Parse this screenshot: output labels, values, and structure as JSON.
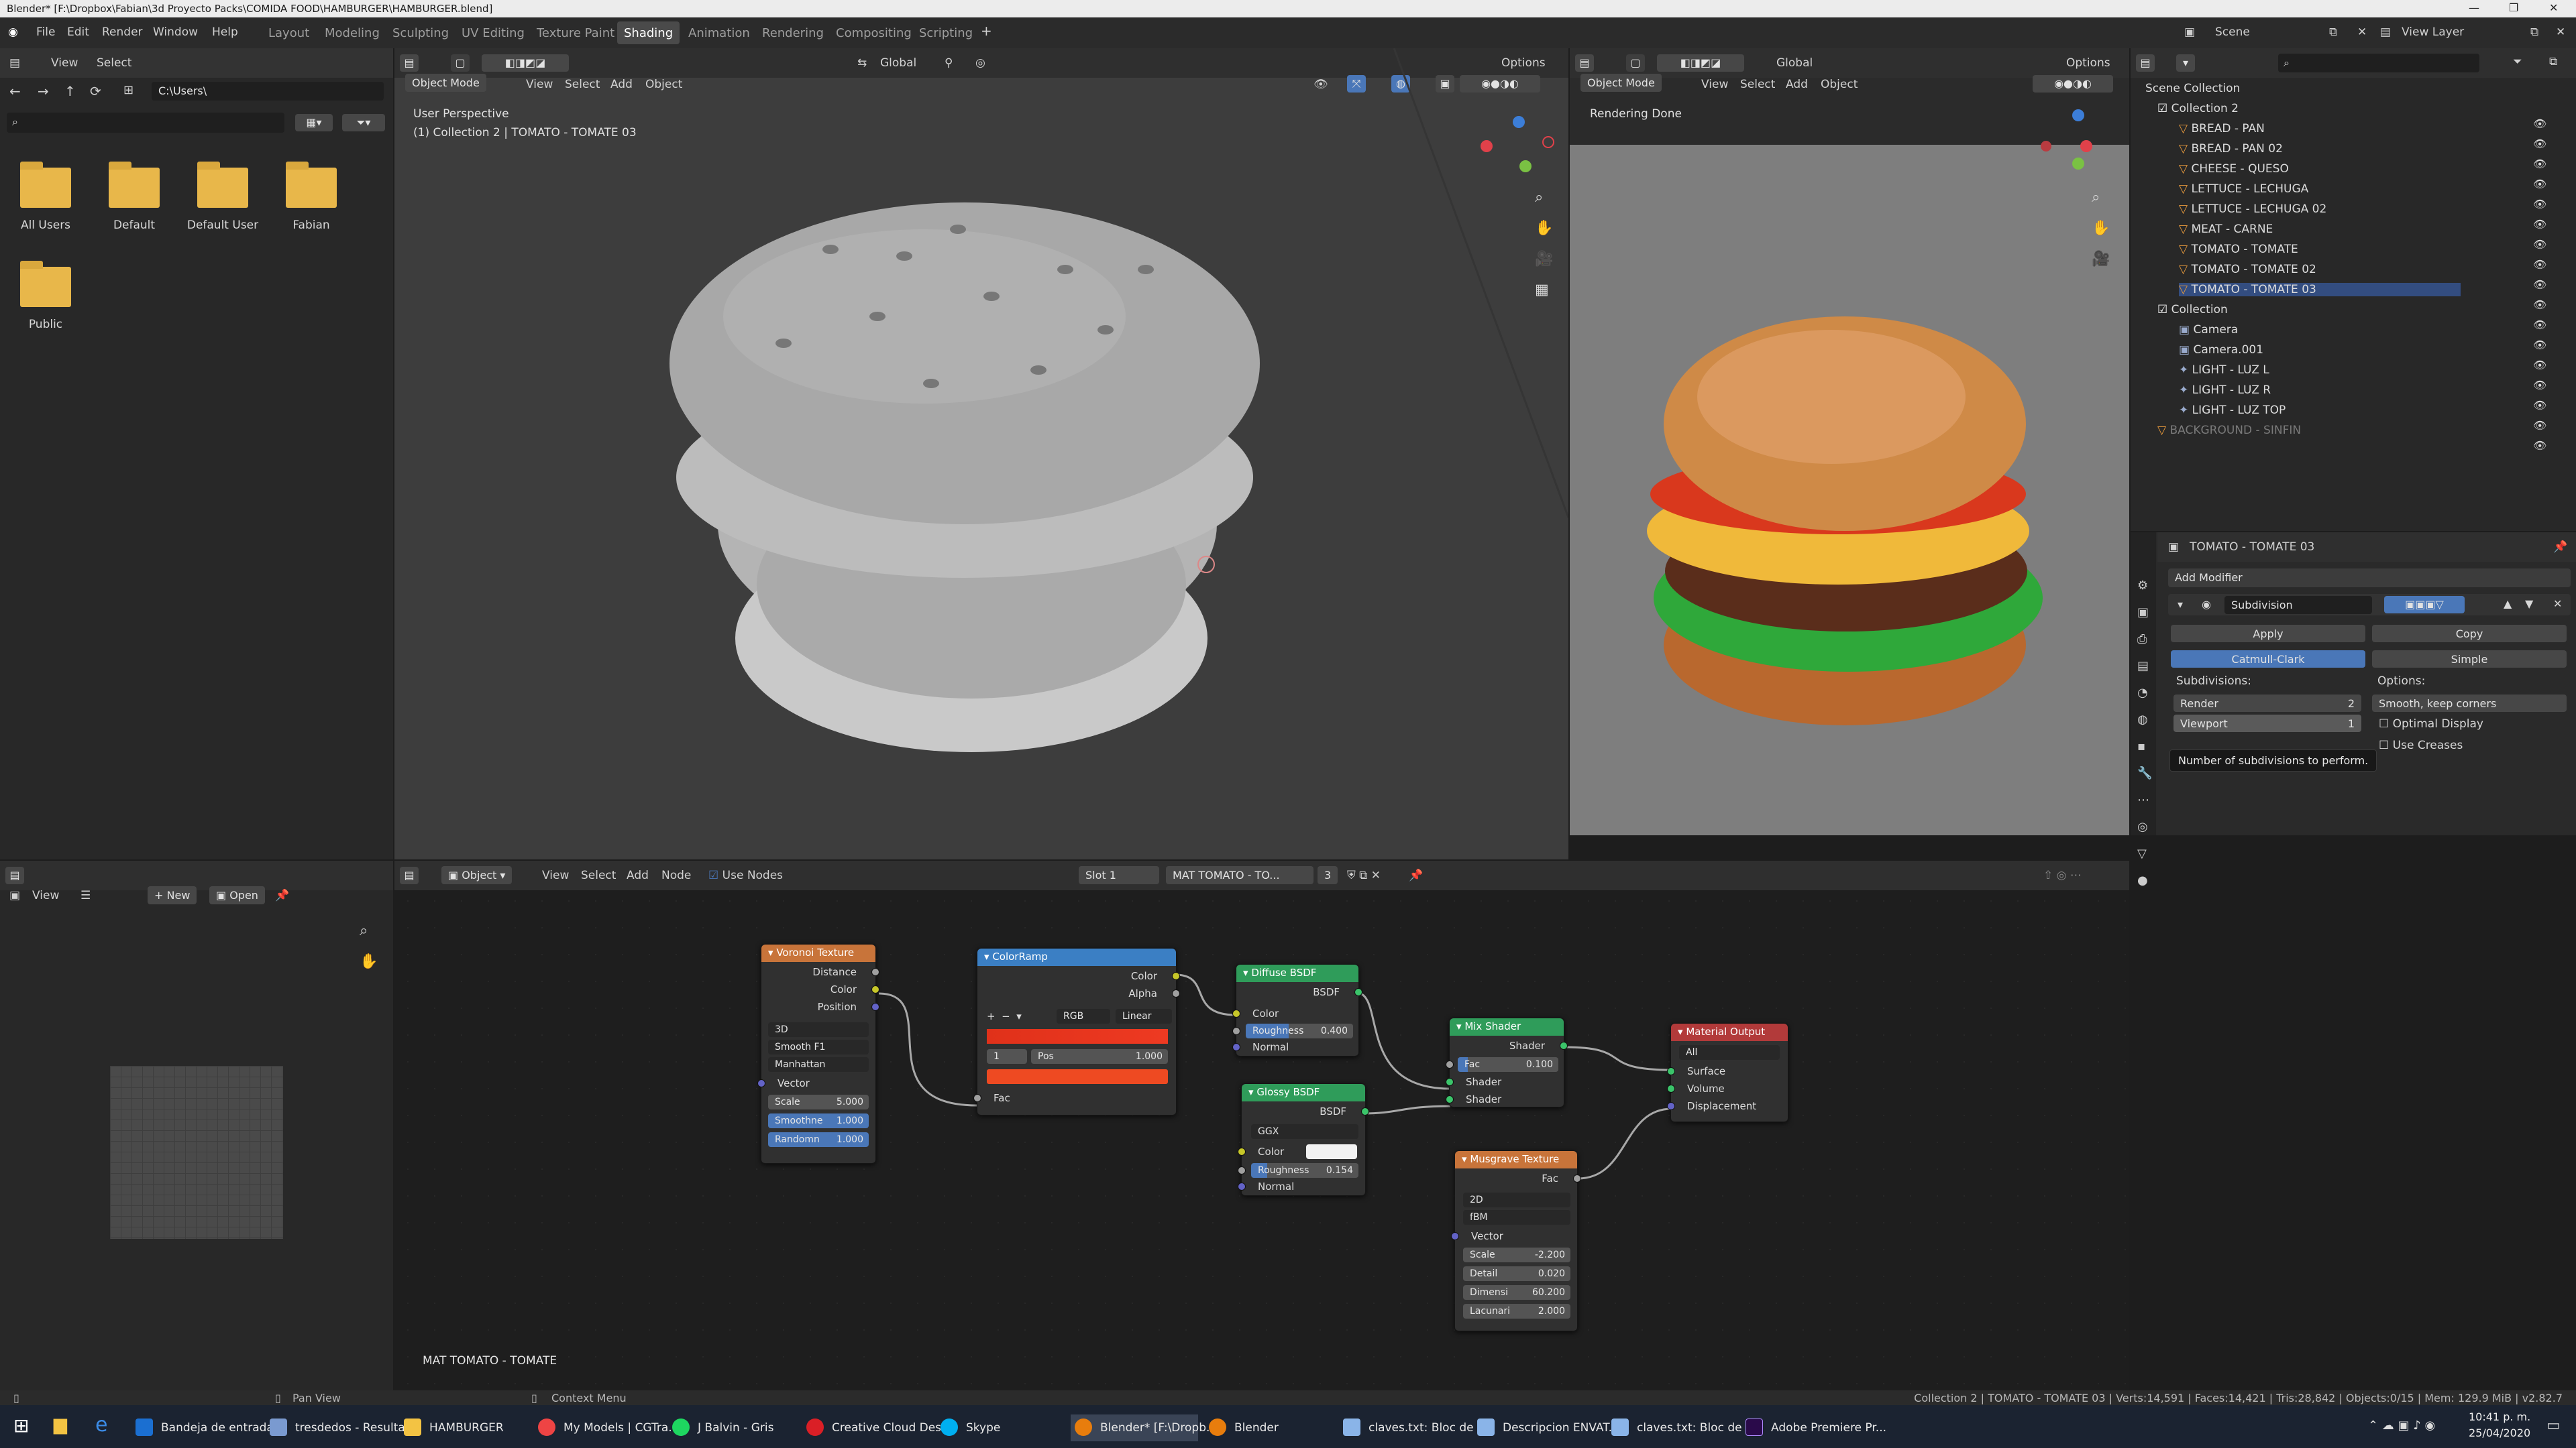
{
  "window": {
    "title": "Blender* [F:\\Dropbox\\Fabian\\3d Proyecto Packs\\COMIDA FOOD\\HAMBURGER\\HAMBURGER.blend]"
  },
  "menu": {
    "items": [
      "File",
      "Edit",
      "Render",
      "Window",
      "Help"
    ]
  },
  "workspaces": [
    "Layout",
    "Modeling",
    "Sculpting",
    "UV Editing",
    "Texture Paint",
    "Shading",
    "Animation",
    "Rendering",
    "Compositing",
    "Scripting"
  ],
  "active_workspace": "Shading",
  "scene": {
    "name": "Scene",
    "view_layer": "View Layer"
  },
  "file_browser": {
    "view": "View",
    "select": "Select",
    "path": "C:\\Users\\",
    "folders": [
      "All Users",
      "Default",
      "Default User",
      "Fabian",
      "Public"
    ]
  },
  "viewport": {
    "mode": "Object Mode",
    "menus": [
      "View",
      "Select",
      "Add",
      "Object"
    ],
    "orientation": "Global",
    "options": "Options",
    "perspective": "User Perspective",
    "collection_info": "(1) Collection 2 | TOMATO - TOMATE 03"
  },
  "render_view": {
    "mode": "Object Mode",
    "menus": [
      "View",
      "Select",
      "Add",
      "Object"
    ],
    "orientation": "Global",
    "options": "Options",
    "status": "Rendering Done"
  },
  "outliner": {
    "root": "Scene Collection",
    "collection2": "Collection 2",
    "items": [
      "BREAD - PAN",
      "BREAD - PAN 02",
      "CHEESE - QUESO",
      "LETTUCE - LECHUGA",
      "LETTUCE - LECHUGA 02",
      "MEAT - CARNE",
      "TOMATO - TOMATE",
      "TOMATO - TOMATE 02",
      "TOMATO - TOMATE 03"
    ],
    "collection": "Collection",
    "items2": [
      "Camera",
      "Camera.001",
      "LIGHT - LUZ L",
      "LIGHT - LUZ R",
      "LIGHT - LUZ TOP"
    ],
    "background": "BACKGROUND - SINFIN"
  },
  "properties": {
    "object": "TOMATO - TOMATE 03",
    "add_modifier": "Add Modifier",
    "modifier": "Subdivision",
    "apply": "Apply",
    "copy": "Copy",
    "catmull": "Catmull-Clark",
    "simple": "Simple",
    "subdivisions": "Subdivisions:",
    "options": "Options:",
    "render_label": "Render",
    "render_val": "2",
    "viewport_label": "Viewport",
    "viewport_val": "1",
    "smooth": "Smooth, keep corners",
    "optimal": "Optimal Display",
    "creases": "Use Creases",
    "tooltip": "Number of subdivisions to perform."
  },
  "image_editor": {
    "view": "View",
    "new": "New",
    "open": "Open"
  },
  "node_editor": {
    "object": "Object",
    "menus": [
      "View",
      "Select",
      "Add",
      "Node"
    ],
    "use_nodes": "Use Nodes",
    "slot": "Slot 1",
    "material": "MAT TOMATO - TO...",
    "users": "3",
    "footer": "MAT TOMATO - TOMATE"
  },
  "nodes": {
    "voronoi": {
      "title": "Voronoi Texture",
      "out": [
        "Distance",
        "Color",
        "Position"
      ],
      "dims": "3D",
      "feature": "Smooth F1",
      "metric": "Manhattan",
      "vector": "Vector",
      "scale": "Scale",
      "scale_v": "5.000",
      "smooth": "Smoothne",
      "smooth_v": "1.000",
      "rand": "Randomn",
      "rand_v": "1.000"
    },
    "colorramp": {
      "title": "ColorRamp",
      "out": [
        "Color",
        "Alpha"
      ],
      "mode": "RGB",
      "interp": "Linear",
      "index": "1",
      "pos": "Pos",
      "pos_v": "1.000",
      "fac": "Fac"
    },
    "diffuse": {
      "title": "Diffuse BSDF",
      "out": "BSDF",
      "color": "Color",
      "rough": "Roughness",
      "rough_v": "0.400",
      "normal": "Normal"
    },
    "glossy": {
      "title": "Glossy BSDF",
      "out": "BSDF",
      "dist": "GGX",
      "color": "Color",
      "rough": "Roughness",
      "rough_v": "0.154",
      "normal": "Normal"
    },
    "mix": {
      "title": "Mix Shader",
      "out": "Shader",
      "fac": "Fac",
      "fac_v": "0.100",
      "in1": "Shader",
      "in2": "Shader"
    },
    "output": {
      "title": "Material Output",
      "target": "All",
      "surface": "Surface",
      "volume": "Volume",
      "disp": "Displacement"
    },
    "musgrave": {
      "title": "Musgrave Texture",
      "out": "Fac",
      "dims": "2D",
      "type": "fBM",
      "vector": "Vector",
      "scale": "Scale",
      "scale_v": "-2.200",
      "detail": "Detail",
      "detail_v": "0.020",
      "dim": "Dimensi",
      "dim_v": "60.200",
      "lac": "Lacunari",
      "lac_v": "2.000"
    }
  },
  "status": {
    "pan": "Pan View",
    "context": "Context Menu",
    "info": "Collection 2 | TOMATO - TOMATE 03 | Verts:14,591 | Faces:14,421 | Tris:28,842 | Objects:0/15 | Mem: 129.9 MiB | v2.82.7"
  },
  "taskbar": {
    "items": [
      "Bandeja de entrada...",
      "tresdedos - Resulta...",
      "HAMBURGER",
      "My Models | CGTra...",
      "J Balvin - Gris",
      "Creative Cloud Des...",
      "Skype",
      "Blender* [F:\\Dropb...",
      "Blender",
      "claves.txt: Bloc de n...",
      "Descripcion ENVAT...",
      "claves.txt: Bloc de n...",
      "Adobe Premiere Pr..."
    ],
    "time": "10:41 p. m.",
    "date": "25/04/2020"
  },
  "colors": {
    "tex_node": "#c8743a",
    "conv_node": "#3b7fc4",
    "shader_node": "#2f9c5a",
    "output_node": "#b23a3a",
    "accent": "#4a77b8"
  }
}
